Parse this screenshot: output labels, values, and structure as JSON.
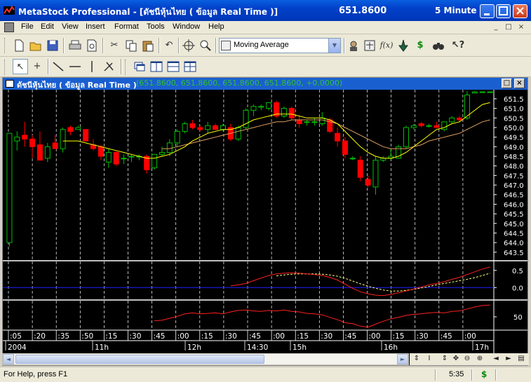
{
  "window": {
    "app_title": "MetaStock Professional - [ดัชนีหุ้นไทย ( ข้อมูล Real Time )]",
    "price": "651.8600",
    "period": "5 Minute",
    "min_icon": "minimize-icon",
    "max_icon": "maximize-icon",
    "close_icon": "close-icon"
  },
  "menu": {
    "items": [
      {
        "label": "File"
      },
      {
        "label": "Edit"
      },
      {
        "label": "View"
      },
      {
        "label": "Insert"
      },
      {
        "label": "Format"
      },
      {
        "label": "Tools"
      },
      {
        "label": "Window"
      },
      {
        "label": "Help"
      }
    ],
    "mdi_controls": [
      "_",
      "□",
      "×"
    ]
  },
  "toolbar1": {
    "indicator_combo": "Moving Average",
    "icons": [
      "new-icon",
      "open-icon",
      "save-icon",
      "print-icon",
      "print-preview-icon",
      "cut-icon",
      "copy-icon",
      "paste-icon",
      "undo-icon",
      "crosshair-icon",
      "zoom-icon",
      "expert-icon",
      "system-tester-icon",
      "formula-icon",
      "explorer-icon",
      "dollar-icon",
      "binoculars-icon",
      "help-icon"
    ]
  },
  "toolbar2": {
    "icons": [
      "pointer-icon",
      "crosshair-tool-icon",
      "trendline-icon",
      "horizontal-line-icon",
      "vertical-line-icon",
      "tools-icon",
      "chart-window-icon",
      "tile-vertical-icon",
      "tile-horizontal-icon",
      "tile-grid-icon"
    ]
  },
  "chart_window": {
    "caption_title": "ดัชนีหุ้นไทย ( ข้อมูล Real Time )",
    "caption_values": "(651.8600, 651.8600, 651.8600, 651.8600, +0.0000)",
    "btn_restore": "□",
    "btn_close": "×"
  },
  "chart_data": {
    "type": "line",
    "price_panel": {
      "y_ticks": [
        "651.5",
        "651.0",
        "650.5",
        "650.0",
        "649.5",
        "649.0",
        "648.5",
        "648.0",
        "647.5",
        "647.0",
        "646.5",
        "646.0",
        "645.5",
        "645.0",
        "644.5",
        "644.0",
        "643.5"
      ],
      "ylim": [
        643.2,
        651.9
      ],
      "candles": [
        {
          "o": 644.0,
          "h": 649.7,
          "l": 643.8,
          "c": 649.7
        },
        {
          "o": 649.3,
          "h": 649.8,
          "l": 648.8,
          "c": 649.5
        },
        {
          "o": 649.6,
          "h": 650.3,
          "l": 649.0,
          "c": 649.4
        },
        {
          "o": 649.4,
          "h": 649.6,
          "l": 648.4,
          "c": 649.0
        },
        {
          "o": 649.1,
          "h": 649.8,
          "l": 648.3,
          "c": 648.3
        },
        {
          "o": 648.4,
          "h": 649.2,
          "l": 648.2,
          "c": 649.0
        },
        {
          "o": 649.2,
          "h": 649.6,
          "l": 648.9,
          "c": 648.9
        },
        {
          "o": 648.9,
          "h": 650.0,
          "l": 648.7,
          "c": 649.9
        },
        {
          "o": 650.0,
          "h": 650.1,
          "l": 649.6,
          "c": 649.8
        },
        {
          "o": 649.9,
          "h": 650.1,
          "l": 649.9,
          "c": 650.0
        },
        {
          "o": 649.9,
          "h": 649.9,
          "l": 649.3,
          "c": 649.3
        },
        {
          "o": 649.1,
          "h": 649.4,
          "l": 648.8,
          "c": 648.9
        },
        {
          "o": 649.0,
          "h": 649.1,
          "l": 648.3,
          "c": 648.5
        },
        {
          "o": 648.2,
          "h": 648.9,
          "l": 647.9,
          "c": 648.7
        },
        {
          "o": 648.7,
          "h": 648.8,
          "l": 648.0,
          "c": 648.1
        },
        {
          "o": 648.4,
          "h": 648.6,
          "l": 648.1,
          "c": 648.4
        },
        {
          "o": 648.5,
          "h": 648.6,
          "l": 648.2,
          "c": 648.5
        },
        {
          "o": 648.5,
          "h": 648.6,
          "l": 648.3,
          "c": 648.5
        },
        {
          "o": 648.5,
          "h": 648.6,
          "l": 647.6,
          "c": 647.8
        },
        {
          "o": 647.9,
          "h": 648.6,
          "l": 647.8,
          "c": 648.6
        },
        {
          "o": 648.6,
          "h": 649.0,
          "l": 648.5,
          "c": 648.7
        },
        {
          "o": 648.7,
          "h": 649.4,
          "l": 648.5,
          "c": 649.2
        },
        {
          "o": 649.2,
          "h": 649.9,
          "l": 649.0,
          "c": 649.8
        },
        {
          "o": 649.8,
          "h": 650.3,
          "l": 649.7,
          "c": 650.2
        },
        {
          "o": 650.2,
          "h": 650.4,
          "l": 649.9,
          "c": 650.0
        },
        {
          "o": 650.0,
          "h": 650.1,
          "l": 649.8,
          "c": 649.9
        },
        {
          "o": 649.9,
          "h": 650.3,
          "l": 649.7,
          "c": 650.1
        },
        {
          "o": 650.1,
          "h": 650.2,
          "l": 649.9,
          "c": 649.9
        },
        {
          "o": 649.9,
          "h": 650.2,
          "l": 649.8,
          "c": 650.1
        },
        {
          "o": 650.0,
          "h": 650.2,
          "l": 649.3,
          "c": 649.4
        },
        {
          "o": 649.4,
          "h": 650.1,
          "l": 649.3,
          "c": 650.0
        },
        {
          "o": 650.0,
          "h": 651.0,
          "l": 649.9,
          "c": 650.9
        },
        {
          "o": 650.9,
          "h": 651.2,
          "l": 650.6,
          "c": 651.1
        },
        {
          "o": 651.1,
          "h": 651.2,
          "l": 650.9,
          "c": 651.1
        },
        {
          "o": 651.0,
          "h": 651.3,
          "l": 650.9,
          "c": 651.3
        },
        {
          "o": 651.3,
          "h": 651.4,
          "l": 650.5,
          "c": 650.6
        },
        {
          "o": 650.6,
          "h": 651.1,
          "l": 650.5,
          "c": 651.0
        },
        {
          "o": 651.0,
          "h": 651.1,
          "l": 650.4,
          "c": 650.5
        },
        {
          "o": 650.4,
          "h": 650.6,
          "l": 650.0,
          "c": 650.2
        },
        {
          "o": 650.3,
          "h": 650.4,
          "l": 650.1,
          "c": 650.3
        },
        {
          "o": 650.3,
          "h": 650.5,
          "l": 650.1,
          "c": 650.3
        },
        {
          "o": 650.2,
          "h": 650.8,
          "l": 650.1,
          "c": 650.5
        },
        {
          "o": 650.4,
          "h": 650.5,
          "l": 649.7,
          "c": 649.8
        },
        {
          "o": 649.7,
          "h": 650.0,
          "l": 649.0,
          "c": 649.3
        },
        {
          "o": 649.3,
          "h": 649.5,
          "l": 648.4,
          "c": 648.6
        },
        {
          "o": 648.4,
          "h": 648.5,
          "l": 648.3,
          "c": 648.4
        },
        {
          "o": 648.3,
          "h": 648.5,
          "l": 647.2,
          "c": 647.4
        },
        {
          "o": 647.3,
          "h": 647.5,
          "l": 646.9,
          "c": 647.0
        },
        {
          "o": 646.9,
          "h": 648.5,
          "l": 646.5,
          "c": 648.3
        },
        {
          "o": 648.3,
          "h": 648.5,
          "l": 648.2,
          "c": 648.4
        },
        {
          "o": 648.4,
          "h": 648.9,
          "l": 648.3,
          "c": 648.5
        },
        {
          "o": 648.4,
          "h": 649.1,
          "l": 648.4,
          "c": 649.0
        },
        {
          "o": 649.0,
          "h": 650.1,
          "l": 648.9,
          "c": 650.0
        },
        {
          "o": 650.0,
          "h": 650.2,
          "l": 649.9,
          "c": 650.1
        },
        {
          "o": 650.2,
          "h": 650.3,
          "l": 650.0,
          "c": 650.1
        },
        {
          "o": 650.1,
          "h": 650.2,
          "l": 650.0,
          "c": 650.1
        },
        {
          "o": 650.1,
          "h": 650.3,
          "l": 650.0,
          "c": 650.0
        },
        {
          "o": 649.9,
          "h": 650.3,
          "l": 649.8,
          "c": 650.3
        },
        {
          "o": 650.3,
          "h": 650.6,
          "l": 650.2,
          "c": 650.5
        },
        {
          "o": 650.5,
          "h": 650.6,
          "l": 650.3,
          "c": 650.4
        },
        {
          "o": 650.5,
          "h": 651.9,
          "l": 650.4,
          "c": 651.7
        },
        {
          "o": 651.8,
          "h": 651.9,
          "l": 651.8,
          "c": 651.86
        },
        {
          "o": 651.86,
          "h": 651.86,
          "l": 651.86,
          "c": 651.86
        },
        {
          "o": 651.86,
          "h": 651.86,
          "l": 651.86,
          "c": 651.86
        }
      ],
      "ma_fast": [
        null,
        null,
        null,
        null,
        null,
        null,
        null,
        649.3,
        649.3,
        649.3,
        649.2,
        649.1,
        649.0,
        648.9,
        648.8,
        648.7,
        648.6,
        648.5,
        648.4,
        648.4,
        648.5,
        648.6,
        648.8,
        649.0,
        649.3,
        649.5,
        649.7,
        649.8,
        649.9,
        649.9,
        650.0,
        650.2,
        650.4,
        650.5,
        650.6,
        650.7,
        650.7,
        650.7,
        650.6,
        650.5,
        650.5,
        650.5,
        650.4,
        650.2,
        649.8,
        649.4,
        649.0,
        648.7,
        648.5,
        648.4,
        648.4,
        648.5,
        648.7,
        649.0,
        649.3,
        649.6,
        649.9,
        650.0,
        650.2,
        650.3,
        650.6,
        650.9,
        651.2,
        651.3
      ],
      "ma_slow": [
        null,
        null,
        null,
        null,
        null,
        null,
        null,
        null,
        null,
        null,
        null,
        null,
        null,
        null,
        null,
        null,
        null,
        null,
        null,
        null,
        648.9,
        648.9,
        649.0,
        649.1,
        649.2,
        649.3,
        649.4,
        649.5,
        649.6,
        649.7,
        649.8,
        649.9,
        650.0,
        650.1,
        650.2,
        650.3,
        650.3,
        650.4,
        650.4,
        650.4,
        650.4,
        650.4,
        650.3,
        650.2,
        650.0,
        649.8,
        649.6,
        649.4,
        649.2,
        649.0,
        648.9,
        648.9,
        648.9,
        649.0,
        649.1,
        649.3,
        649.4,
        649.5,
        649.6,
        649.7,
        649.9,
        650.1,
        650.3,
        650.4
      ]
    },
    "osc_panel": {
      "y_ticks": [
        "0.5",
        "0.0"
      ],
      "ylim": [
        -0.3,
        0.7
      ],
      "line": [
        null,
        null,
        null,
        null,
        null,
        null,
        null,
        null,
        null,
        null,
        null,
        null,
        null,
        null,
        null,
        null,
        null,
        null,
        null,
        null,
        null,
        null,
        null,
        null,
        null,
        null,
        null,
        null,
        null,
        0.05,
        0.08,
        0.12,
        0.2,
        0.28,
        0.35,
        0.4,
        0.42,
        0.43,
        0.42,
        0.4,
        0.38,
        0.35,
        0.3,
        0.22,
        0.1,
        -0.02,
        -0.12,
        -0.18,
        -0.22,
        -0.23,
        -0.2,
        -0.15,
        -0.1,
        -0.04,
        0.02,
        0.08,
        0.12,
        0.17,
        0.24,
        0.3,
        0.38,
        0.46,
        0.54,
        0.6
      ],
      "signal": [
        null,
        null,
        null,
        null,
        null,
        null,
        null,
        null,
        null,
        null,
        null,
        null,
        null,
        null,
        null,
        null,
        null,
        null,
        null,
        null,
        null,
        null,
        null,
        null,
        null,
        null,
        null,
        null,
        null,
        null,
        null,
        null,
        null,
        null,
        null,
        0.34,
        0.37,
        0.39,
        0.4,
        0.4,
        0.4,
        0.39,
        0.37,
        0.33,
        0.27,
        0.19,
        0.11,
        0.04,
        -0.02,
        -0.07,
        -0.1,
        -0.1,
        -0.08,
        -0.05,
        -0.01,
        0.03,
        0.08,
        0.12,
        0.16,
        0.2,
        0.24,
        0.29,
        0.35,
        0.42
      ]
    },
    "rsi_panel": {
      "y_ticks": [
        "50"
      ],
      "ylim": [
        20,
        80
      ],
      "line": [
        null,
        null,
        null,
        null,
        null,
        null,
        null,
        null,
        null,
        null,
        null,
        null,
        null,
        null,
        null,
        null,
        null,
        null,
        null,
        42,
        43,
        47,
        51,
        56,
        58,
        56,
        57,
        58,
        56,
        60,
        63,
        64,
        62,
        61,
        63,
        62,
        64,
        61,
        60,
        57,
        56,
        54,
        49,
        44,
        38,
        36,
        31,
        29,
        35,
        41,
        46,
        49,
        53,
        55,
        56,
        58,
        59,
        58,
        61,
        62,
        66,
        70,
        73,
        74
      ]
    },
    "x_time_labels": [
      ":05",
      ":20",
      ":35",
      ":50",
      ":15",
      ":30",
      ":45",
      ":00",
      ":15",
      ":30",
      ":45",
      ":00",
      ":15",
      ":30",
      ":45",
      ":00",
      ":15",
      ":30",
      ":45",
      ":00"
    ],
    "x_date_labels": [
      "2004",
      "11h",
      "12h",
      "14:30",
      "15h",
      "16h",
      "17h"
    ],
    "colors": {
      "up": "#00c000",
      "down": "#ff0000",
      "ma_fast": "#ffff00",
      "ma_slow": "#e0a060",
      "osc": "#ff2020",
      "signal": "#ffff80",
      "zero": "#2020ff",
      "grid": "#ffffff"
    }
  },
  "scroll": {
    "left_arrow": "◄",
    "right_arrow": "►"
  },
  "nav_buttons": [
    "⇕",
    "I",
    "⇕",
    "✥",
    "⊖",
    "⊕",
    "◄",
    "►",
    "▤"
  ],
  "status": {
    "help_text": "For Help, press F1",
    "time": "5:35",
    "dollar": "$"
  }
}
